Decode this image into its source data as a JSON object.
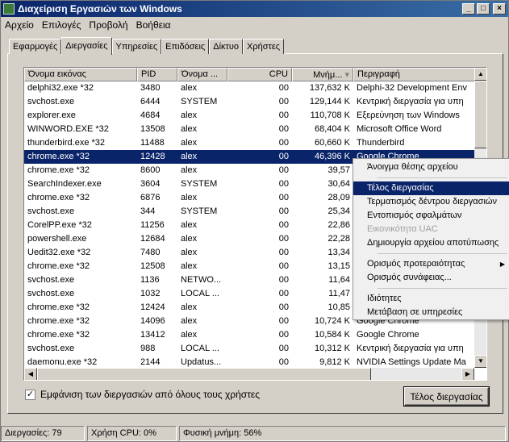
{
  "window": {
    "title": "Διαχείριση Εργασιών των Windows",
    "min_label": "_",
    "max_label": "□",
    "close_label": "×"
  },
  "menu": [
    "Αρχείο",
    "Επιλογές",
    "Προβολή",
    "Βοήθεια"
  ],
  "tabs": [
    {
      "label": "Εφαρμογές",
      "active": false
    },
    {
      "label": "Διεργασίες",
      "active": true
    },
    {
      "label": "Υπηρεσίες",
      "active": false
    },
    {
      "label": "Επιδόσεις",
      "active": false
    },
    {
      "label": "Δίκτυο",
      "active": false
    },
    {
      "label": "Χρήστες",
      "active": false
    }
  ],
  "table": {
    "columns": [
      "Όνομα εικόνας",
      "PID",
      "Όνομα ...",
      "CPU",
      "Μνήμ...",
      "Περιγραφή"
    ],
    "sort_indicator": "▾",
    "rows": [
      [
        "delphi32.exe *32",
        "3480",
        "alex",
        "00",
        "137,632 K",
        "Delphi-32 Development Env"
      ],
      [
        "svchost.exe",
        "6444",
        "SYSTEM",
        "00",
        "129,144 K",
        "Κεντρική διεργασία για υπη"
      ],
      [
        "explorer.exe",
        "4684",
        "alex",
        "00",
        "110,708 K",
        "Εξερεύνηση των Windows"
      ],
      [
        "WINWORD.EXE *32",
        "13508",
        "alex",
        "00",
        "68,404 K",
        "Microsoft Office Word"
      ],
      [
        "thunderbird.exe *32",
        "11488",
        "alex",
        "00",
        "60,660 K",
        "Thunderbird"
      ],
      [
        "chrome.exe *32",
        "12428",
        "alex",
        "00",
        "46,396 K",
        "Google Chrome"
      ],
      [
        "chrome.exe *32",
        "8600",
        "alex",
        "00",
        "39,57",
        ""
      ],
      [
        "SearchIndexer.exe",
        "3604",
        "SYSTEM",
        "00",
        "30,64",
        ""
      ],
      [
        "chrome.exe *32",
        "6876",
        "alex",
        "00",
        "28,09",
        ""
      ],
      [
        "svchost.exe",
        "344",
        "SYSTEM",
        "00",
        "25,34",
        ""
      ],
      [
        "CorelPP.exe *32",
        "11256",
        "alex",
        "00",
        "22,86",
        ""
      ],
      [
        "powershell.exe",
        "12684",
        "alex",
        "00",
        "22,28",
        ""
      ],
      [
        "Uedit32.exe *32",
        "7480",
        "alex",
        "00",
        "13,34",
        ""
      ],
      [
        "chrome.exe *32",
        "12508",
        "alex",
        "00",
        "13,15",
        ""
      ],
      [
        "svchost.exe",
        "1136",
        "NETWO...",
        "00",
        "11,64",
        ""
      ],
      [
        "svchost.exe",
        "1032",
        "LOCAL ...",
        "00",
        "11,47",
        ""
      ],
      [
        "chrome.exe *32",
        "12424",
        "alex",
        "00",
        "10,85",
        ""
      ],
      [
        "chrome.exe *32",
        "14096",
        "alex",
        "00",
        "10,724 K",
        "Google Chrome"
      ],
      [
        "chrome.exe *32",
        "13412",
        "alex",
        "00",
        "10,584 K",
        "Google Chrome"
      ],
      [
        "svchost.exe",
        "988",
        "LOCAL ...",
        "00",
        "10,312 K",
        "Κεντρική διεργασία για υπη"
      ],
      [
        "daemonu.exe *32",
        "2144",
        "Updatus...",
        "00",
        "9,812 K",
        "NVIDIA Settings Update Ma"
      ]
    ],
    "selected_row_index": 5
  },
  "context_menu": {
    "groups": [
      [
        {
          "label": "Άνοιγμα θέσης αρχείου",
          "disabled": false
        }
      ],
      [
        {
          "label": "Τέλος διεργασίας",
          "highlight": true
        },
        {
          "label": "Τερματισμός δέντρου διεργασιών"
        },
        {
          "label": "Εντοπισμός σφαλμάτων"
        },
        {
          "label": "Εικονικότητα UAC",
          "disabled": true
        },
        {
          "label": "Δημιουργία αρχείου αποτύπωσης"
        }
      ],
      [
        {
          "label": "Ορισμός προτεραιότητας",
          "submenu": true
        },
        {
          "label": "Ορισμός συνάφειας..."
        }
      ],
      [
        {
          "label": "Ιδιότητες"
        },
        {
          "label": "Μετάβαση σε υπηρεσίες"
        }
      ]
    ]
  },
  "show_all_users": {
    "label": "Εμφάνιση των διεργασιών από όλους τους χρήστες",
    "checked": true,
    "mark": "✓"
  },
  "end_process_button": "Τέλος διεργασίας",
  "status": {
    "processes": "Διεργασίες: 79",
    "cpu": "Χρήση CPU: 0%",
    "memory": "Φυσική μνήμη: 56%"
  }
}
